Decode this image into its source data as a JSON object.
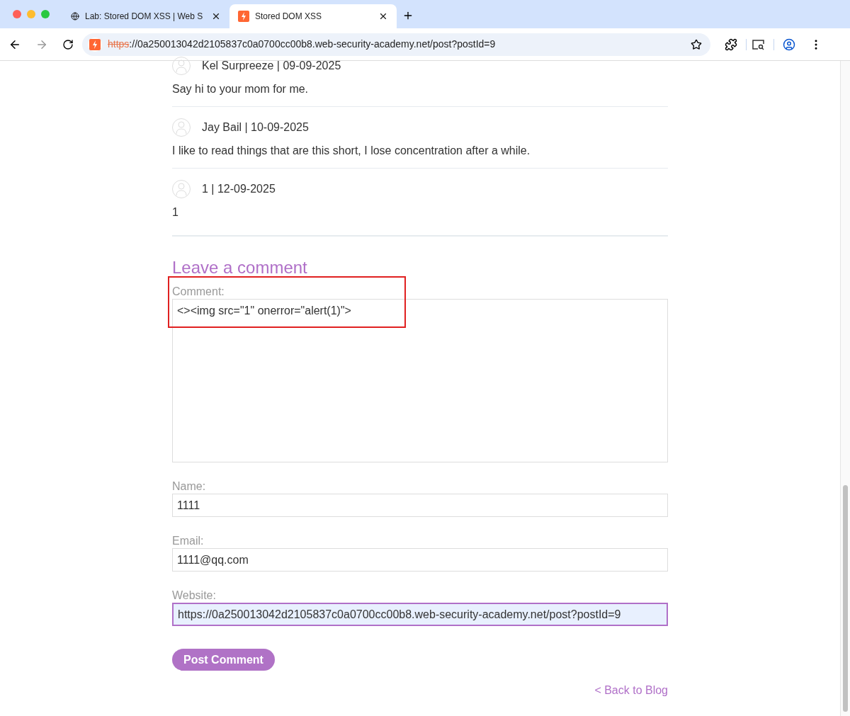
{
  "browser": {
    "tabs": [
      {
        "title": "Lab: Stored DOM XSS | Web S",
        "selected": false
      },
      {
        "title": "Stored DOM XSS",
        "selected": true
      }
    ],
    "url": {
      "scheme": "https",
      "rest": "://0a250013042d2105837c0a0700cc00b8.web-security-academy.net/post?postId=9"
    }
  },
  "comments": [
    {
      "header": "Kel Surpreeze | 09-09-2025",
      "body": "Say hi to your mom for me."
    },
    {
      "header": "Jay Bail | 10-09-2025",
      "body": "I like to read things that are this short, I lose concentration after a while."
    },
    {
      "header": "1 | 12-09-2025",
      "body": "1"
    }
  ],
  "form": {
    "title": "Leave a comment",
    "fields": [
      {
        "kind": "textarea",
        "label": "Comment:",
        "value": "<><img src=\"1\" onerror=\"alert(1)\">",
        "focused": false,
        "highlighted": true
      },
      {
        "kind": "input",
        "label": "Name:",
        "value": "1111",
        "focused": false,
        "highlighted": false
      },
      {
        "kind": "input",
        "label": "Email:",
        "value": "1111@qq.com",
        "focused": false,
        "highlighted": false
      },
      {
        "kind": "input",
        "label": "Website:",
        "value": "https://0a250013042d2105837c0a0700cc00b8.web-security-academy.net/post?postId=9",
        "focused": true,
        "highlighted": false
      }
    ],
    "submit": "Post Comment",
    "back_link": "< Back to Blog"
  }
}
